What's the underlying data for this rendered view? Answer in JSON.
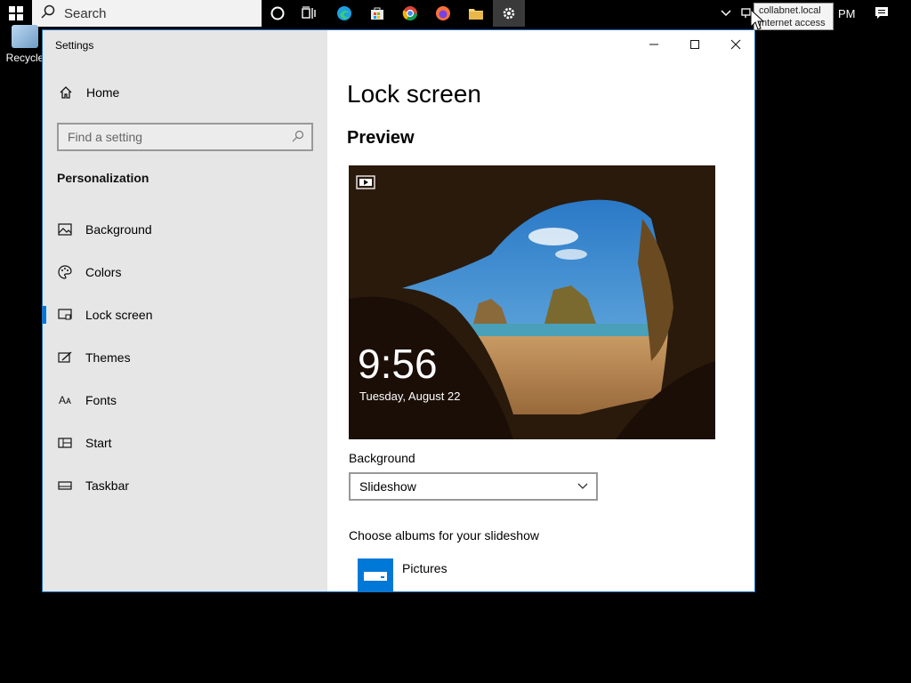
{
  "taskbar": {
    "search_placeholder": "Search",
    "tray_time_fragment": "PM"
  },
  "desktop": {
    "recycle_bin_label": "Recycle"
  },
  "tooltip": {
    "line1": "collabnet.local",
    "line2": "Internet access"
  },
  "window": {
    "title": "Settings"
  },
  "sidebar": {
    "home_label": "Home",
    "search_placeholder": "Find a setting",
    "section": "Personalization",
    "items": [
      {
        "label": "Background",
        "icon": "picture-icon",
        "selected": false
      },
      {
        "label": "Colors",
        "icon": "palette-icon",
        "selected": false
      },
      {
        "label": "Lock screen",
        "icon": "lock-screen-icon",
        "selected": true
      },
      {
        "label": "Themes",
        "icon": "themes-icon",
        "selected": false
      },
      {
        "label": "Fonts",
        "icon": "fonts-icon",
        "selected": false
      },
      {
        "label": "Start",
        "icon": "start-icon",
        "selected": false
      },
      {
        "label": "Taskbar",
        "icon": "taskbar-icon",
        "selected": false
      }
    ]
  },
  "main": {
    "title": "Lock screen",
    "preview_heading": "Preview",
    "preview_time": "9:56",
    "preview_date": "Tuesday, August 22",
    "background_label": "Background",
    "background_value": "Slideshow",
    "albums_label": "Choose albums for your slideshow",
    "album_name": "Pictures"
  },
  "colors": {
    "accent": "#0078d7",
    "sidebar_bg": "#e6e6e6"
  }
}
